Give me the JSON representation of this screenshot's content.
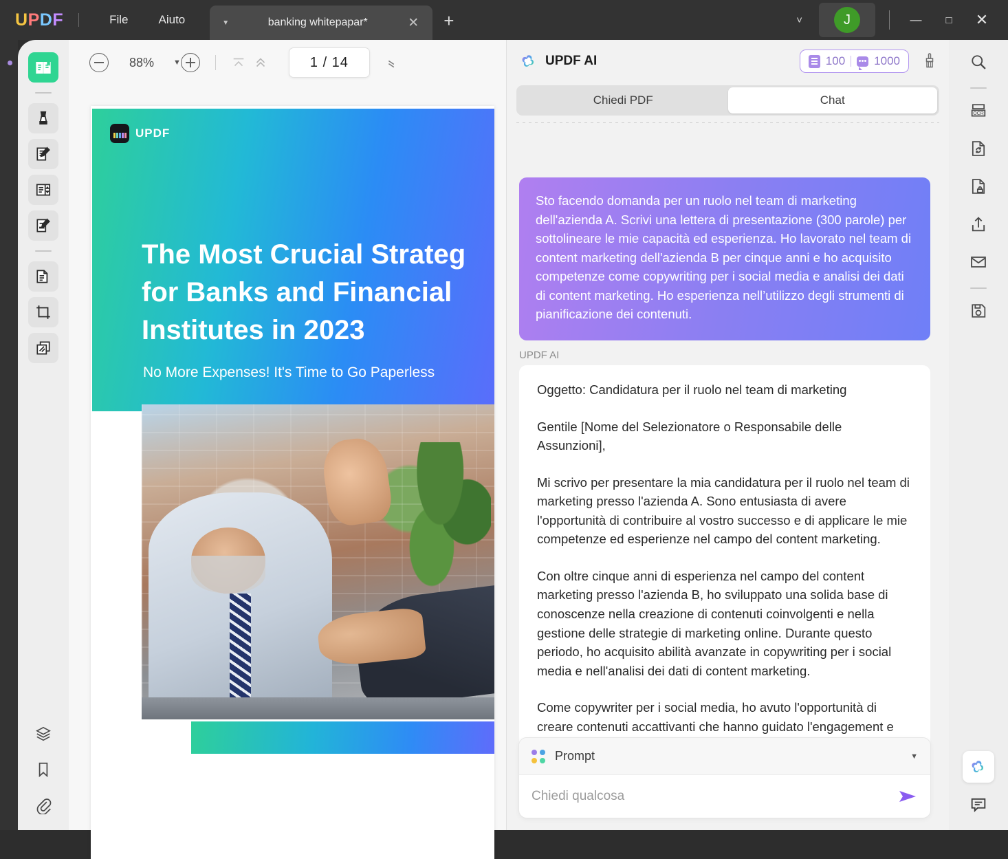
{
  "window": {
    "logo_letters": [
      "U",
      "P",
      "D",
      "F"
    ],
    "menus": [
      {
        "label": "File",
        "name": "menu-file"
      },
      {
        "label": "Aiuto",
        "name": "menu-aiuto"
      }
    ],
    "tab": {
      "title": "banking whitepapar*",
      "caret_icon": "caret-down-icon",
      "close_icon": "close-icon"
    },
    "new_tab_icon": "plus-icon",
    "chevron_icon": "chevron-down-icon",
    "avatar_initial": "J",
    "avatar_color": "#3f9b28",
    "controls": {
      "minimize": "—",
      "maximize": "□",
      "close": "✕"
    }
  },
  "left_tools": {
    "items": [
      {
        "label": "Reader",
        "name": "sidebar-item-reader",
        "icon": "reader-icon",
        "active": true
      },
      {
        "label": "Commenta",
        "name": "sidebar-item-comment",
        "icon": "highlighter-marker-icon",
        "active": false
      },
      {
        "label": "Modifica PDF",
        "name": "sidebar-item-edit-pdf",
        "icon": "edit-document-icon",
        "active": false
      },
      {
        "label": "Organizza pagine",
        "name": "sidebar-item-organize-pages",
        "icon": "organize-pages-icon",
        "active": false
      },
      {
        "label": "Modulo",
        "name": "sidebar-item-form",
        "icon": "form-edit-icon",
        "active": false
      },
      {
        "label": "Converti",
        "name": "sidebar-item-convert",
        "icon": "convert-document-icon",
        "active": false
      },
      {
        "label": "Ritaglia",
        "name": "sidebar-item-crop",
        "icon": "crop-icon",
        "active": false
      },
      {
        "label": "Comprimi",
        "name": "sidebar-item-compress",
        "icon": "compress-pages-icon",
        "active": false
      }
    ],
    "bottom_items": [
      {
        "label": "Livelli",
        "name": "sidebar-item-layers",
        "icon": "layers-icon"
      },
      {
        "label": "Segnalibri",
        "name": "sidebar-item-bookmarks",
        "icon": "bookmark-icon"
      },
      {
        "label": "Allegati",
        "name": "sidebar-item-attachments",
        "icon": "paperclip-icon"
      }
    ]
  },
  "doc_toolbar": {
    "zoom_out_icon": "zoom-out-circle-icon",
    "zoom_level": "88%",
    "zoom_caret_icon": "caret-down-icon",
    "zoom_in_icon": "zoom-in-circle-icon",
    "first_page_icon": "first-page-icon",
    "prev_page_icon": "prev-page-icon",
    "page_current": "1",
    "page_separator": "/",
    "page_total": "14",
    "page_display": "1 / 14",
    "collapse_icon": "collapse-toolbar-icon"
  },
  "pdf_page": {
    "brand": "UPDF",
    "title_lines": [
      "The Most Crucial Strateg",
      "for Banks and Financial",
      "Institutes in 2023"
    ],
    "subtitle": "No More Expenses! It's Time to Go Paperless",
    "gradient_from": "#2ecf9b",
    "gradient_to": "#5f6cfb"
  },
  "ai_panel": {
    "brand_icon": "updf-ai-flower-icon",
    "title": "UPDF AI",
    "credits": {
      "doc_icon": "document-credit-icon",
      "doc_count": "100",
      "chat_icon": "chat-credit-icon",
      "chat_count": "1000",
      "accent": "#b295f0"
    },
    "clear_icon": "brush-clear-icon",
    "tabs": [
      {
        "label": "Chiedi PDF",
        "name": "tab-chiedi-pdf",
        "active": false
      },
      {
        "label": "Chat",
        "name": "tab-chat",
        "active": true
      }
    ],
    "messages": [
      {
        "role": "user",
        "text": "Sto facendo domanda per un ruolo nel team di marketing dell'azienda A. Scrivi una lettera di presentazione (300 parole) per sottolineare le mie capacità ed esperienza. Ho lavorato nel team di content marketing dell'azienda B per cinque anni e ho acquisito competenze come copywriting per i social media e analisi dei dati di content marketing. Ho esperienza nell’utilizzo degli strumenti di pianificazione dei contenuti."
      },
      {
        "role": "assistant",
        "author_label": "UPDF AI",
        "paragraphs": [
          "Oggetto: Candidatura per il ruolo nel team di marketing",
          "Gentile [Nome del Selezionatore o Responsabile delle Assunzioni],",
          "Mi scrivo per presentare la mia candidatura per il ruolo nel team di marketing presso l'azienda A. Sono entusiasta di avere l'opportunità di contribuire al vostro successo e di applicare le mie competenze ed esperienze nel campo del content marketing.",
          "Con oltre cinque anni di esperienza nel campo del content marketing presso l'azienda B, ho sviluppato una solida base di conoscenze nella creazione di contenuti coinvolgenti e nella gestione delle strategie di marketing online. Durante questo periodo, ho acquisito abilità avanzate in copywriting per i social media e nell'analisi dei dati di content marketing.",
          "Come copywriter per i social media, ho avuto l'opportunità di creare contenuti accattivanti che hanno guidato l'engagement e aumentato la visibilità del marchio dell'azienda B. Ho lavorato a"
        ]
      }
    ],
    "composer": {
      "prompt_icon": "four-dots-prompt-icon",
      "prompt_label": "Prompt",
      "prompt_caret_icon": "caret-down-icon",
      "input_value": "",
      "input_placeholder": "Chiedi qualcosa",
      "send_icon": "send-arrow-icon",
      "send_color": "#8a5cf0"
    }
  },
  "right_tools": {
    "items": [
      {
        "label": "Cerca",
        "name": "right-item-search",
        "icon": "search-icon"
      },
      {
        "label": "OCR",
        "name": "right-item-ocr",
        "icon": "ocr-icon"
      },
      {
        "label": "Converti",
        "name": "right-item-convert",
        "icon": "convert-file-icon"
      },
      {
        "label": "Proteggi",
        "name": "right-item-protect",
        "icon": "lock-document-icon"
      },
      {
        "label": "Condividi",
        "name": "right-item-share",
        "icon": "share-upload-icon"
      },
      {
        "label": "Email",
        "name": "right-item-email",
        "icon": "envelope-icon"
      },
      {
        "label": "Salva",
        "name": "right-item-save",
        "icon": "save-disk-icon"
      }
    ],
    "bottom_items": [
      {
        "label": "UPDF AI",
        "name": "right-item-updf-ai",
        "icon": "updf-ai-flower-icon",
        "active": true
      },
      {
        "label": "Commenti",
        "name": "right-item-comments",
        "icon": "comment-bubble-icon",
        "active": false
      }
    ]
  }
}
